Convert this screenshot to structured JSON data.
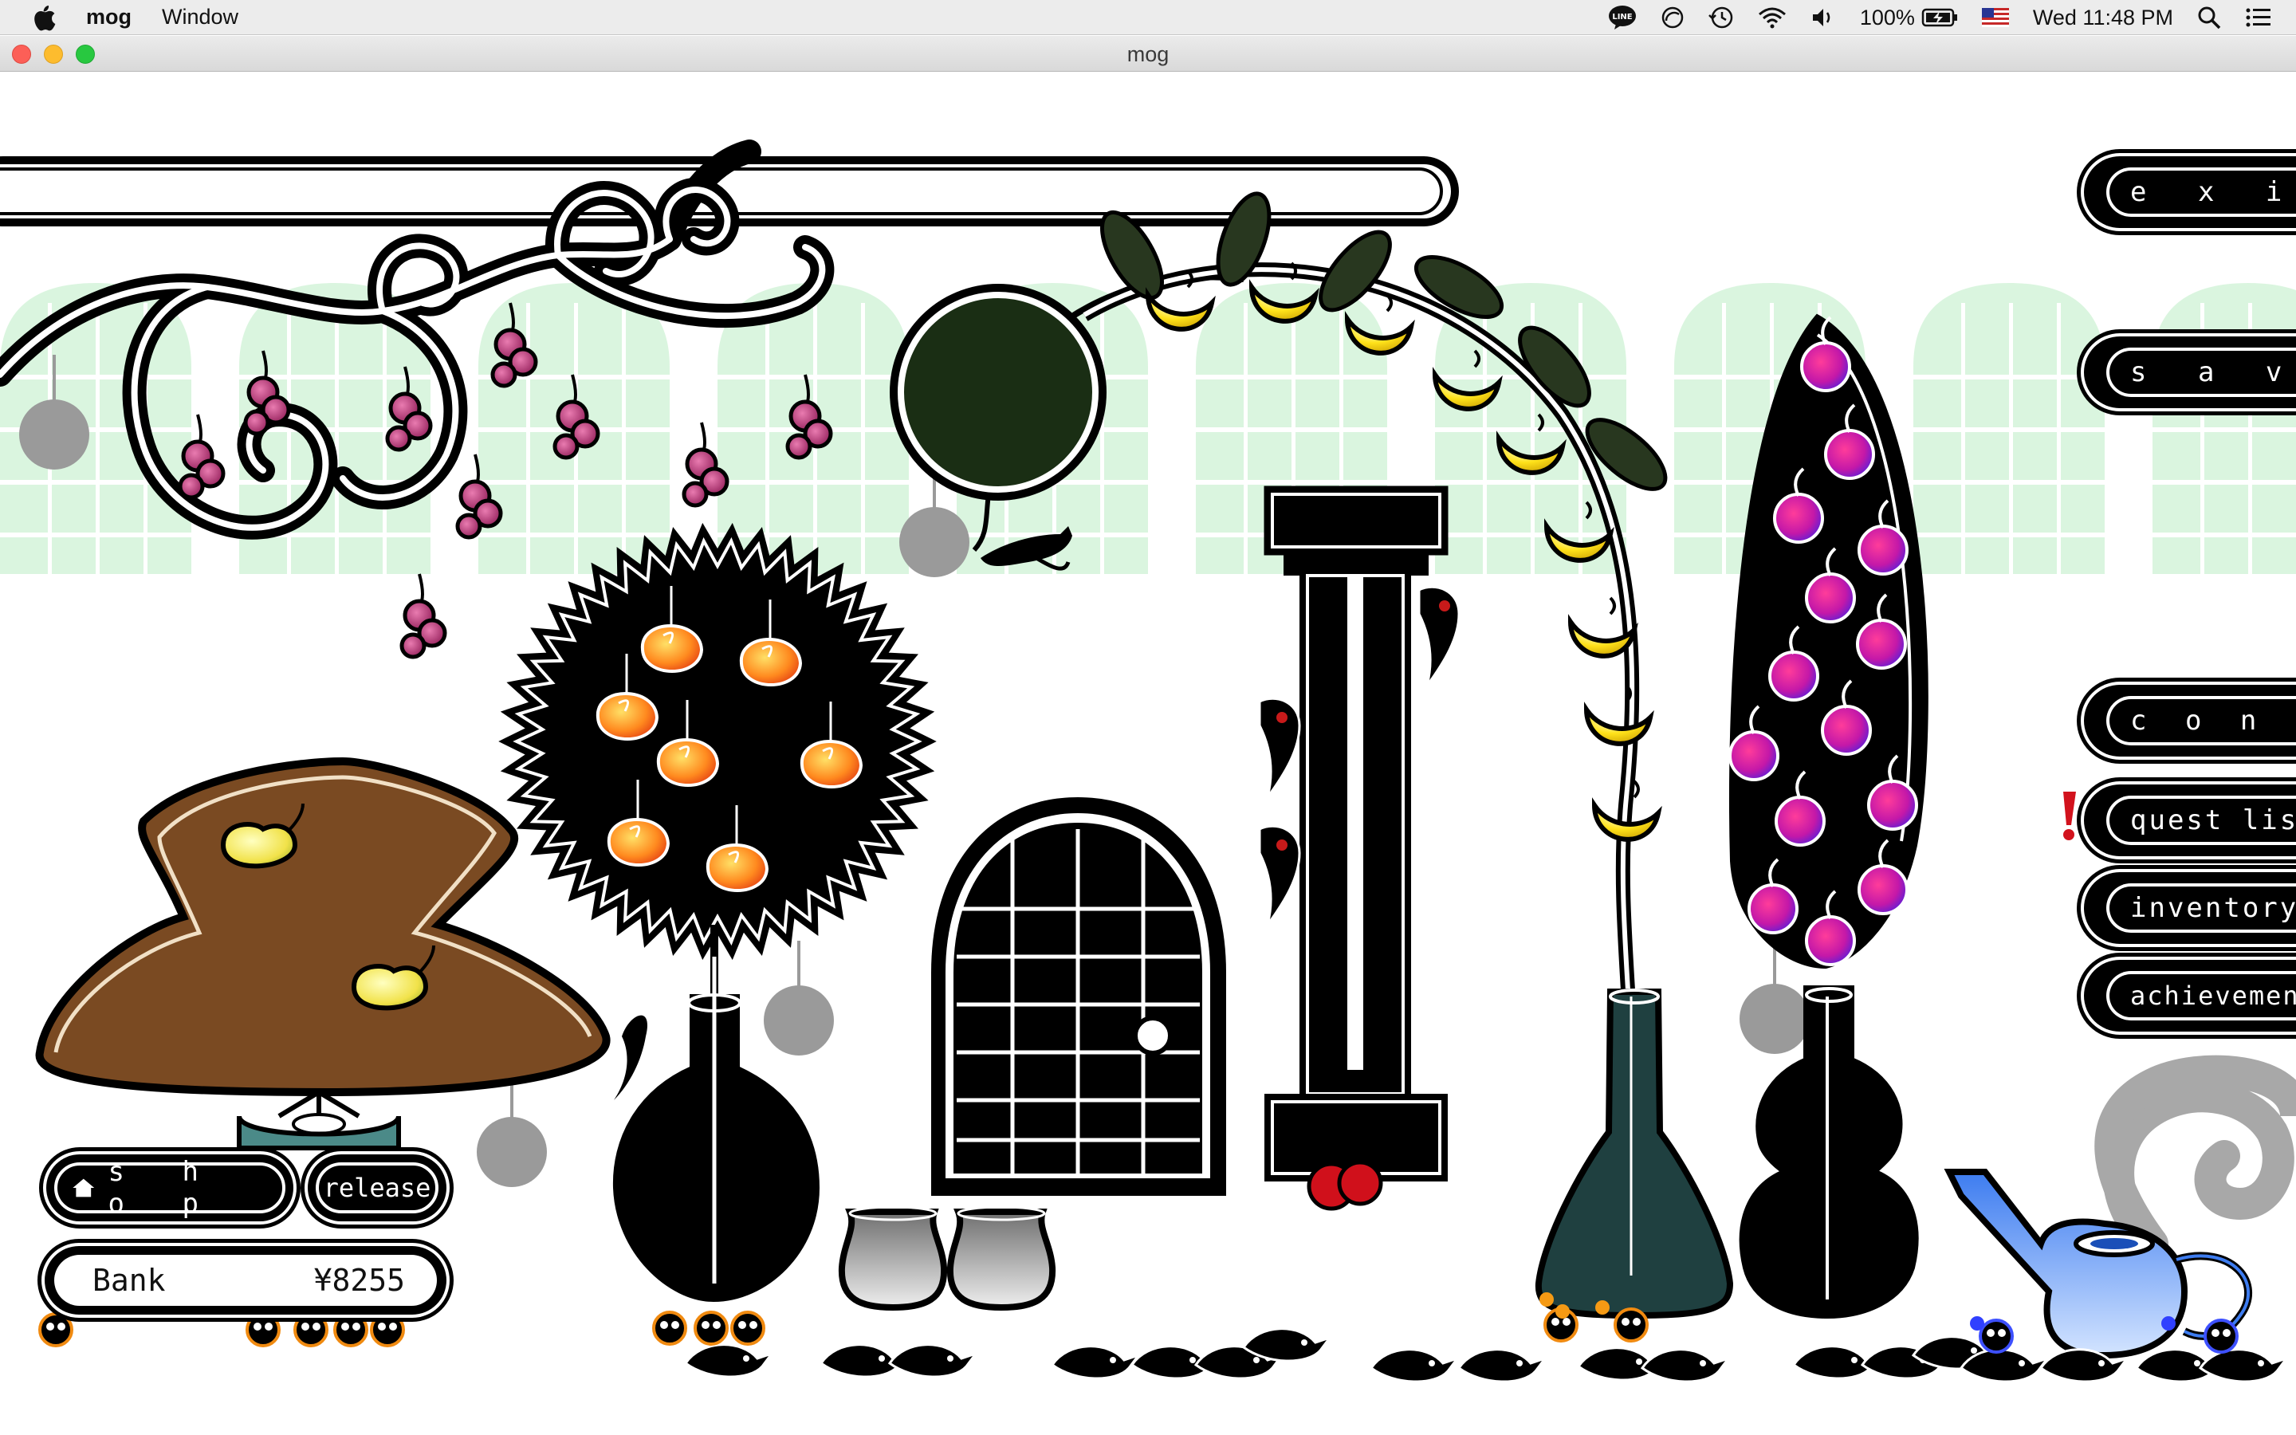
{
  "menubar": {
    "app_name": "mog",
    "menus": [
      "Window"
    ],
    "battery": "100%",
    "clock": "Wed 11:48 PM",
    "icons": [
      "apple-icon",
      "line-app-icon",
      "do-not-disturb-icon",
      "time-machine-icon",
      "wifi-icon",
      "volume-icon",
      "battery-charging-icon",
      "us-flag-icon",
      "spotlight-search-icon",
      "notification-center-icon"
    ]
  },
  "window": {
    "title": "mog"
  },
  "game": {
    "side_menu": {
      "exit": "e x i t",
      "save": "s a v e",
      "config": "c o n f i g",
      "quest_list": "quest list",
      "inventory": "inventory",
      "achievement": "achievement"
    },
    "quest_alert": "!",
    "shop_label": "s h o p",
    "release_label": "release",
    "bank": {
      "label": "Bank",
      "amount": "¥8255"
    },
    "colors": {
      "background": "#ffffff",
      "lattice": "#d6f4dc",
      "outline": "#000000",
      "mound": "#7a4a22",
      "teal_flask": "#1f4040",
      "watering_can": "#3d7cf0"
    }
  }
}
